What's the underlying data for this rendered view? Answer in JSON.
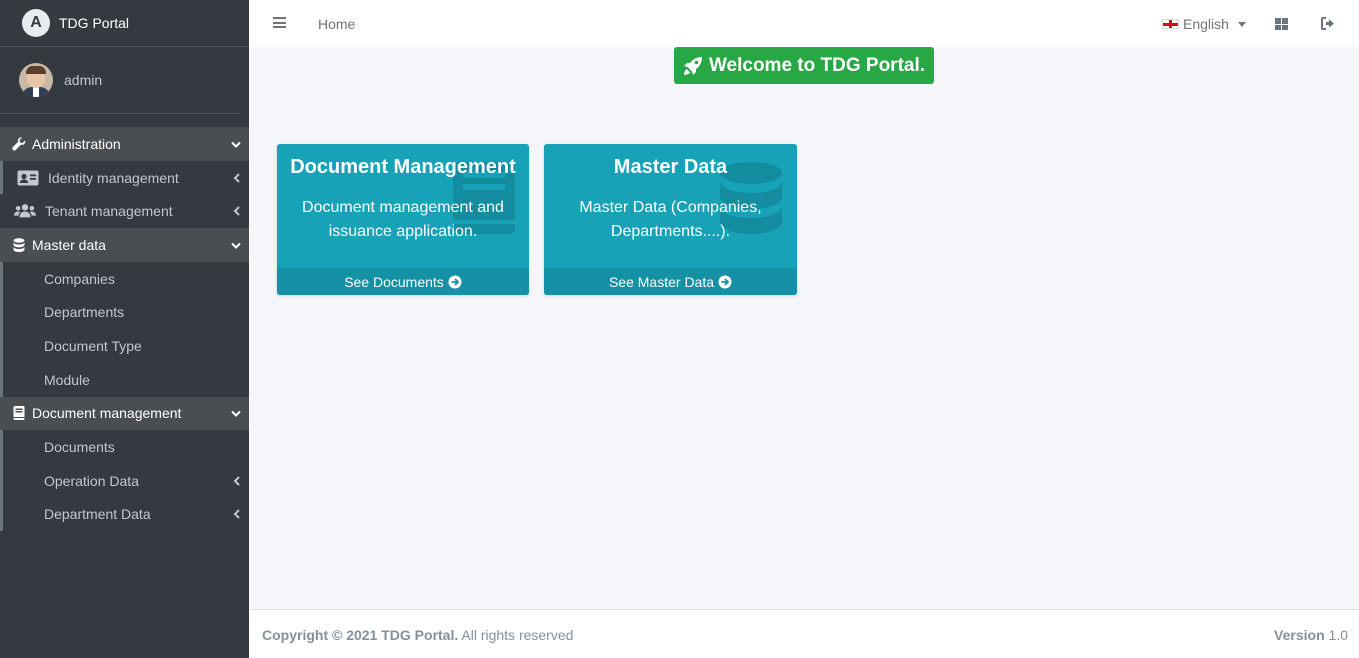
{
  "brand": {
    "name": "TDG Portal",
    "logo_letter": "A"
  },
  "user": {
    "name": "admin"
  },
  "sidebar": {
    "items": [
      {
        "label": "Administration",
        "icon": "wrench-icon"
      },
      {
        "label": "Identity management",
        "icon": "id-card-icon"
      },
      {
        "label": "Tenant management",
        "icon": "users-icon"
      },
      {
        "label": "Master data",
        "icon": "database-icon"
      },
      {
        "label": "Companies"
      },
      {
        "label": "Departments"
      },
      {
        "label": "Document Type"
      },
      {
        "label": "Module"
      },
      {
        "label": "Document management",
        "icon": "book-icon"
      },
      {
        "label": "Documents"
      },
      {
        "label": "Operation Data"
      },
      {
        "label": "Department Data"
      }
    ]
  },
  "topbar": {
    "home_label": "Home",
    "language": "English"
  },
  "welcome": {
    "text": "Welcome to TDG Portal."
  },
  "cards": [
    {
      "title": "Document Management",
      "text": "Document management and issuance application.",
      "link": "See Documents"
    },
    {
      "title": "Master Data",
      "text": "Master Data (Companies, Departments....).",
      "link": "See Master Data"
    }
  ],
  "footer": {
    "copyright": "Copyright © 2021 TDG Portal.",
    "rights": " All rights reserved",
    "version_label": "Version",
    "version_value": " 1.0"
  },
  "colors": {
    "sidebar_bg": "#343a40",
    "card_bg": "#17a2b8",
    "welcome_bg": "#28a745",
    "content_bg": "#f4f6f9"
  }
}
